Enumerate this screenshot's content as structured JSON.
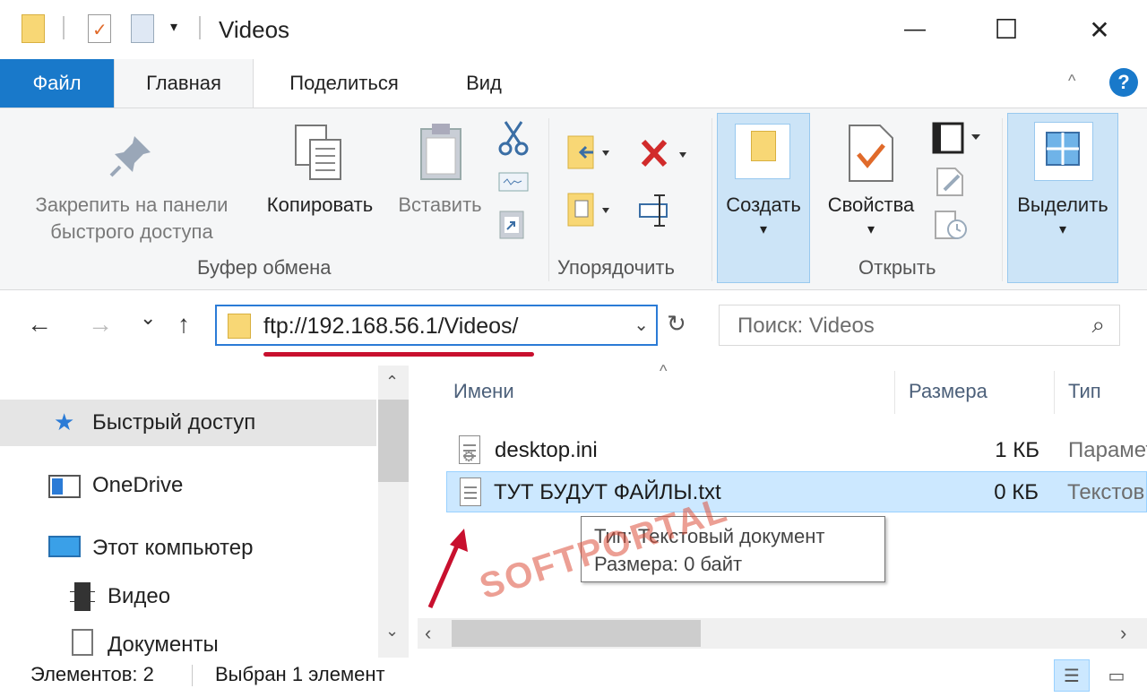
{
  "window": {
    "title": "Videos",
    "minimize": "—",
    "maximize": "☐",
    "close": "✕"
  },
  "quick_access_toolbar": {
    "dropdown": "▾"
  },
  "ribbon": {
    "tabs": [
      {
        "label": "Файл"
      },
      {
        "label": "Главная"
      },
      {
        "label": "Поделиться"
      },
      {
        "label": "Вид"
      }
    ],
    "collapse": "^",
    "help": "?",
    "clipboard": {
      "group_label": "Буфер обмена",
      "pin_line1": "Закрепить на панели",
      "pin_line2": "быстрого доступа",
      "copy": "Копировать",
      "paste": "Вставить"
    },
    "organize": {
      "group_label": "Упорядочить"
    },
    "create": {
      "label": "Создать",
      "caret": "▾"
    },
    "open": {
      "group_label": "Открыть",
      "properties": "Свойства",
      "caret": "▾"
    },
    "select": {
      "label": "Выделить",
      "caret": "▾"
    }
  },
  "navigation": {
    "back": "←",
    "forward": "→",
    "recent": "⌄",
    "up": "↑",
    "address": "ftp://192.168.56.1/Videos/",
    "address_chevron": "⌄",
    "refresh": "↻",
    "search_placeholder": "Поиск: Videos",
    "search_icon": "⌕"
  },
  "nav_pane": {
    "items": [
      {
        "label": "Быстрый доступ",
        "icon": "star-icon",
        "selected": true
      },
      {
        "label": "OneDrive",
        "icon": "onedrive-icon",
        "selected": false
      },
      {
        "label": "Этот компьютер",
        "icon": "computer-icon",
        "selected": false
      },
      {
        "label": "Видео",
        "icon": "video-folder-icon",
        "selected": false
      },
      {
        "label": "Документы",
        "icon": "documents-icon",
        "selected": false
      }
    ]
  },
  "file_list": {
    "columns": [
      "Имени",
      "Размера",
      "Тип"
    ],
    "sort_indicator": "^",
    "rows": [
      {
        "name": "desktop.ini",
        "size": "1 КБ",
        "type": "Парамет",
        "icon": "settings-file-icon",
        "selected": false
      },
      {
        "name": "ТУТ БУДУТ ФАЙЛЫ.txt",
        "size": "0 КБ",
        "type": "Текстов",
        "icon": "text-file-icon",
        "selected": true
      }
    ],
    "tooltip": {
      "line1": "Тип: Текстовый документ",
      "line2": "Размера: 0 байт"
    }
  },
  "watermark": "SOFTPORTAL",
  "status_bar": {
    "items_count": "Элементов: 2",
    "selection": "Выбран 1 элемент"
  },
  "colors": {
    "accent": "#1979ca",
    "selection": "#cce8ff",
    "annotation_red": "#c8102e"
  }
}
